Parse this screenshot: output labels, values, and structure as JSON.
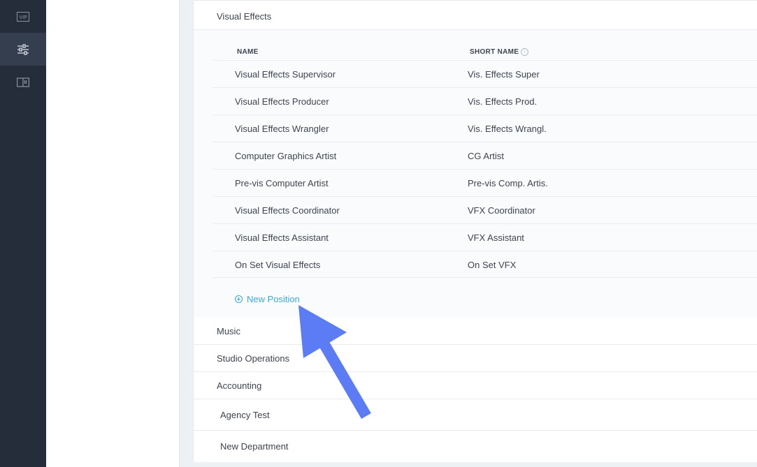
{
  "rail": {
    "vip_label": "VIP"
  },
  "section": {
    "title": "Visual Effects",
    "columns": {
      "name": "NAME",
      "short_name": "SHORT NAME"
    },
    "info_glyph": "i",
    "positions": [
      {
        "name": "Visual Effects Supervisor",
        "short": "Vis. Effects Super"
      },
      {
        "name": "Visual Effects Producer",
        "short": "Vis. Effects Prod."
      },
      {
        "name": "Visual Effects Wrangler",
        "short": "Vis. Effects Wrangl."
      },
      {
        "name": "Computer Graphics Artist",
        "short": "CG Artist"
      },
      {
        "name": "Pre-vis Computer Artist",
        "short": "Pre-vis Comp. Artis."
      },
      {
        "name": "Visual Effects Coordinator",
        "short": "VFX Coordinator"
      },
      {
        "name": "Visual Effects Assistant",
        "short": "VFX Assistant"
      },
      {
        "name": "On Set Visual Effects",
        "short": "On Set VFX"
      }
    ],
    "new_position_label": "New Position"
  },
  "departments": [
    {
      "label": "Music"
    },
    {
      "label": "Studio Operations"
    },
    {
      "label": "Accounting"
    },
    {
      "label": "Agency Test"
    },
    {
      "label": "New Department"
    }
  ],
  "colors": {
    "rail": "#262d3a",
    "accent": "#3aa9e0",
    "annotation_arrow": "#5b7cf5"
  }
}
